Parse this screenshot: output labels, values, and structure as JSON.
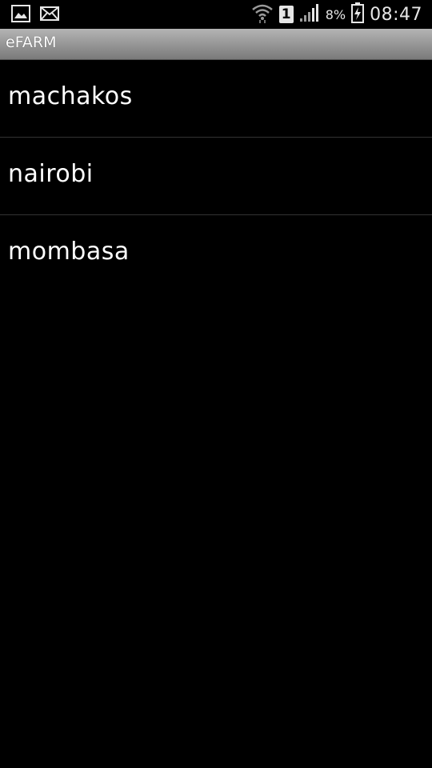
{
  "status_bar": {
    "left_icons": [
      "gallery-icon",
      "mail-icon"
    ],
    "sim_slot": "1",
    "battery_percent": "8%",
    "time": "08:47",
    "right_icons": [
      "wifi-icon",
      "sim-icon",
      "signal-icon",
      "battery-icon"
    ]
  },
  "app": {
    "title": "eFARM"
  },
  "list": {
    "items": [
      {
        "label": "machakos"
      },
      {
        "label": "nairobi"
      },
      {
        "label": "mombasa"
      }
    ]
  }
}
